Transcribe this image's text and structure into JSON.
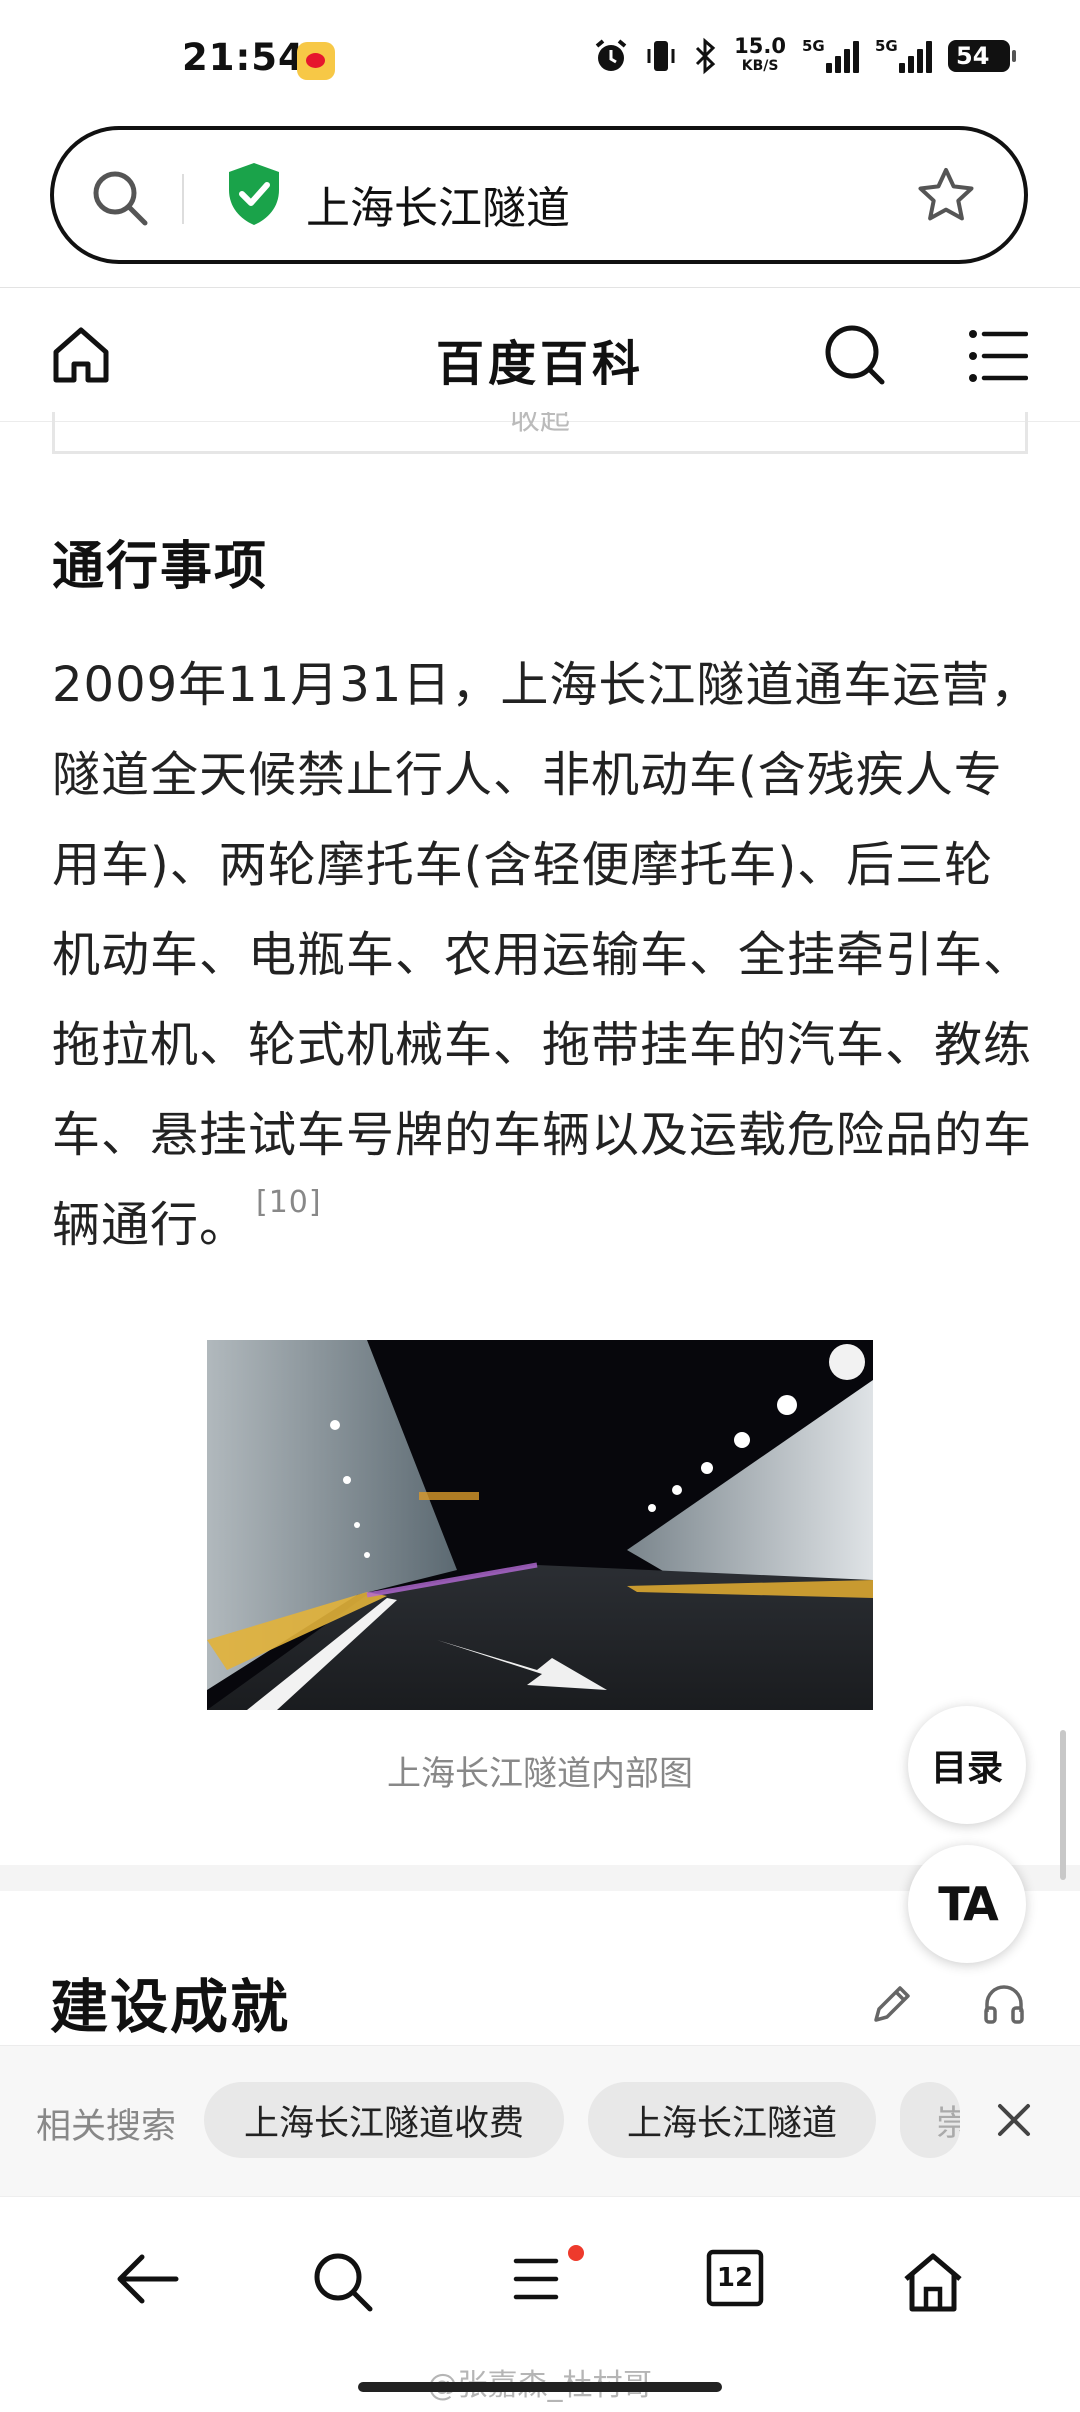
{
  "status_bar": {
    "time": "21:54",
    "app_icon": "weibo-icon",
    "net_speed": "15.0",
    "net_speed_unit": "KB/S",
    "signal1_label": "5G",
    "signal2_label": "5G",
    "battery": "54",
    "icons": [
      "alarm-icon",
      "vibrate-icon",
      "bluetooth-icon"
    ]
  },
  "address_bar": {
    "query": "上海长江隧道",
    "icons": [
      "search-icon",
      "shield-check-icon",
      "star-icon"
    ],
    "shield_color": "#1aa34a"
  },
  "header": {
    "title": "百度百科",
    "icons": [
      "home-icon",
      "search-icon",
      "menu-icon"
    ]
  },
  "previous_box_text": "收起",
  "section1": {
    "heading": "通行事项",
    "body": "2009年11月31日，上海长江隧道通车运营，隧道全天候禁止行人、非机动车(含残疾人专用车)、两轮摩托车(含轻便摩托车)、后三轮机动车、电瓶车、农用运输车、全挂牵引车、拖拉机、轮式机械车、拖带挂车的汽车、教练车、悬挂试车号牌的车辆以及运载危险品的车辆通行。",
    "citation": "[10]",
    "image_caption": "上海长江隧道内部图"
  },
  "section2": {
    "heading": "建设成就",
    "icons": [
      "edit-icon",
      "headphones-icon"
    ]
  },
  "fab": {
    "toc_label": "目录",
    "ta_label": "TA"
  },
  "related": {
    "label": "相关搜索",
    "chips": [
      "上海长江隧道收费",
      "上海长江隧道",
      "崇"
    ],
    "close_icon": "close-icon"
  },
  "bottom_nav": {
    "icons": [
      "back-arrow-icon",
      "search-icon",
      "menu-icon",
      "tabs-icon",
      "home-icon"
    ],
    "tab_count": "12",
    "badge_color": "#ee3a2c"
  },
  "watermark": "@张嘉森_杜村哥"
}
